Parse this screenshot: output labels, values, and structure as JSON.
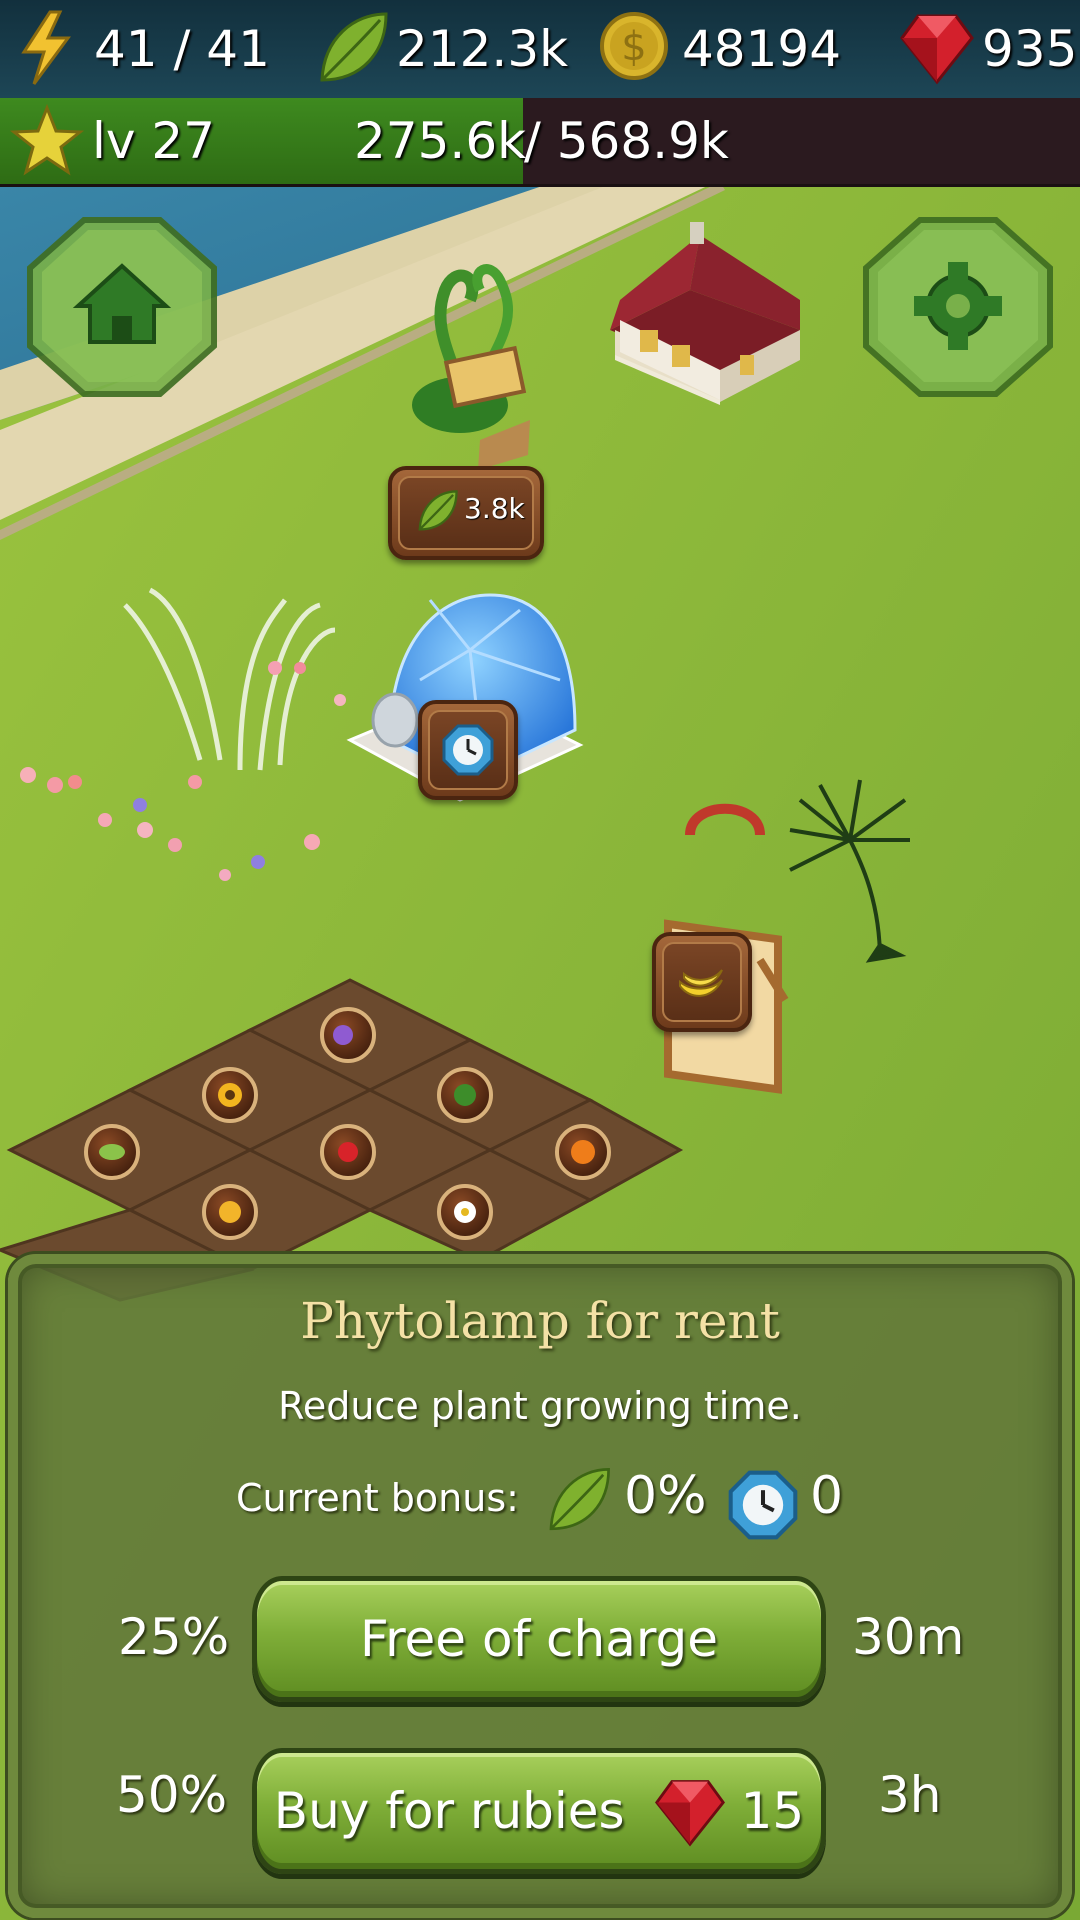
{
  "hud": {
    "energy": "41 / 41",
    "leaves": "212.3k",
    "coins": "48194",
    "rubies": "935",
    "level": "lv 27",
    "xp_current": "275.6k",
    "xp_max": "/ 568.9k",
    "xp_progress": 0.484
  },
  "map": {
    "beanstalk_price": "3.8k"
  },
  "panel": {
    "title": "Phytolamp for rent",
    "description": "Reduce plant growing time.",
    "current_bonus_label": "Current bonus:",
    "bonus_growth": "0%",
    "bonus_time": "0",
    "options": [
      {
        "percent": "25%",
        "label": "Free of charge",
        "duration": "30m"
      },
      {
        "percent": "50%",
        "label": "Buy for rubies",
        "price": "15",
        "duration": "3h"
      }
    ]
  },
  "colors": {
    "accent_green": "#7fae38",
    "title_gold": "#f4e1a6",
    "xp_fill": "#3e8a1f"
  },
  "icons": [
    "lightning-icon",
    "leaf-icon",
    "coin-icon",
    "ruby-icon",
    "star-icon",
    "home-icon",
    "settings-gear-icon",
    "clock-icon",
    "banana-icon"
  ]
}
